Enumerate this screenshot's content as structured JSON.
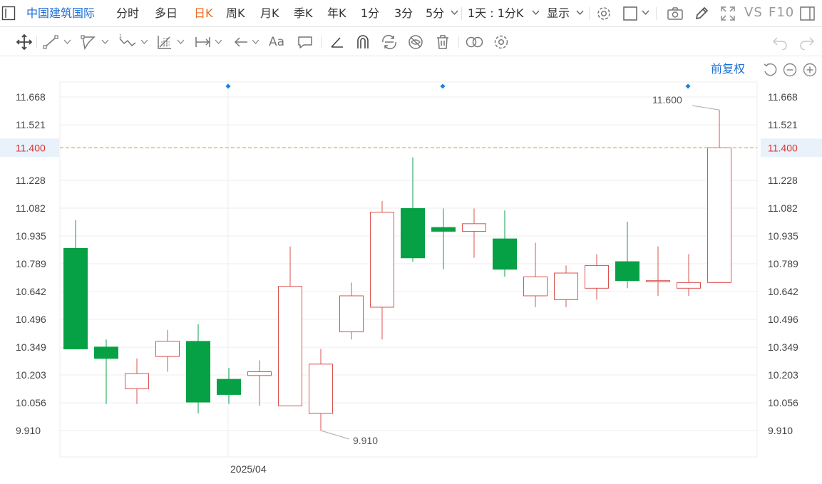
{
  "toolbar": {
    "stock_name": "中国建筑国际",
    "periods": [
      "分时",
      "多日",
      "日K",
      "周K",
      "月K",
      "季K",
      "年K",
      "1分",
      "3分",
      "5分"
    ],
    "active_period": "日K",
    "interval_select": "1天 : 1分K",
    "display_select": "显示",
    "vs_label": "VS",
    "f10_label": "F10"
  },
  "drawing_tools": {
    "text_tool_label": "Aa"
  },
  "chart": {
    "adjust_mode": "前复权",
    "x_label": "2025/04",
    "max_label": "11.600",
    "min_label": "9.910",
    "current_price_label": "11.400",
    "colors": {
      "up": "#d9534f",
      "down": "#07a145",
      "current_line": "#f0a050",
      "current_text": "#e0302a",
      "grid": "#eeeeee"
    }
  },
  "chart_data": {
    "type": "candlestick",
    "x_tick": "2025/04",
    "y_ticks": [
      "11.668",
      "11.521",
      "11.400",
      "11.228",
      "11.082",
      "10.935",
      "10.789",
      "10.642",
      "10.496",
      "10.349",
      "10.203",
      "10.056",
      "9.910"
    ],
    "ylim": [
      9.8,
      11.78
    ],
    "current_price": 11.4,
    "candles": [
      {
        "open": 10.87,
        "high": 11.02,
        "low": 10.34,
        "close": 10.34
      },
      {
        "open": 10.35,
        "high": 10.39,
        "low": 10.05,
        "close": 10.29
      },
      {
        "open": 10.13,
        "high": 10.29,
        "low": 10.05,
        "close": 10.21
      },
      {
        "open": 10.3,
        "high": 10.44,
        "low": 10.22,
        "close": 10.38
      },
      {
        "open": 10.38,
        "high": 10.47,
        "low": 10.0,
        "close": 10.06
      },
      {
        "open": 10.18,
        "high": 10.24,
        "low": 10.05,
        "close": 10.1
      },
      {
        "open": 10.2,
        "high": 10.28,
        "low": 10.04,
        "close": 10.22
      },
      {
        "open": 10.04,
        "high": 10.88,
        "low": 10.04,
        "close": 10.67
      },
      {
        "open": 10.0,
        "high": 10.34,
        "low": 9.91,
        "close": 10.26
      },
      {
        "open": 10.43,
        "high": 10.69,
        "low": 10.39,
        "close": 10.62
      },
      {
        "open": 10.56,
        "high": 11.12,
        "low": 10.39,
        "close": 11.06
      },
      {
        "open": 11.08,
        "high": 11.35,
        "low": 10.8,
        "close": 10.82
      },
      {
        "open": 10.98,
        "high": 11.08,
        "low": 10.76,
        "close": 10.96
      },
      {
        "open": 10.96,
        "high": 11.08,
        "low": 10.82,
        "close": 11.0
      },
      {
        "open": 10.92,
        "high": 11.07,
        "low": 10.72,
        "close": 10.76
      },
      {
        "open": 10.62,
        "high": 10.9,
        "low": 10.56,
        "close": 10.72
      },
      {
        "open": 10.6,
        "high": 10.78,
        "low": 10.56,
        "close": 10.74
      },
      {
        "open": 10.66,
        "high": 10.84,
        "low": 10.6,
        "close": 10.78
      },
      {
        "open": 10.8,
        "high": 11.01,
        "low": 10.66,
        "close": 10.7
      },
      {
        "open": 10.7,
        "high": 10.88,
        "low": 10.62,
        "close": 10.7
      },
      {
        "open": 10.66,
        "high": 10.84,
        "low": 10.62,
        "close": 10.69
      },
      {
        "open": 10.69,
        "high": 11.6,
        "low": 10.69,
        "close": 11.4
      }
    ]
  }
}
